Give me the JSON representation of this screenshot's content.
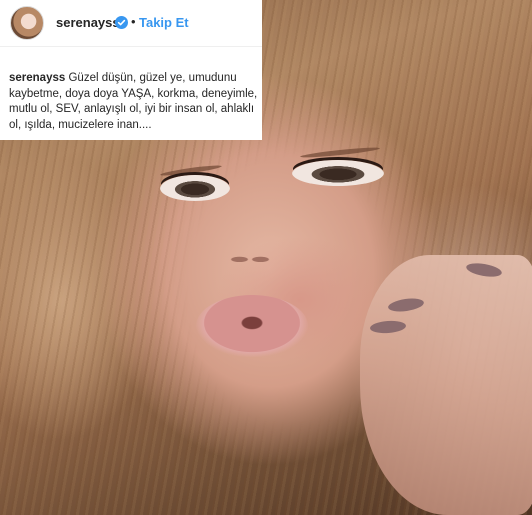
{
  "post": {
    "username": "serenayss",
    "separator": "•",
    "follow_label": "Takip Et",
    "caption_username": "serenayss",
    "caption_text": "Güzel düşün, güzel ye, umudunu kaybetme, doya doya YAŞA, korkma, deneyimle, mutlu ol, SEV, anlayışlı ol, iyi bir insan ol, ahlaklı ol, ışılda, mucizelere inan...."
  },
  "icons": {
    "verified": "verified-badge-icon"
  },
  "colors": {
    "follow": "#3897f0",
    "text": "#262626",
    "verified": "#3897f0"
  }
}
